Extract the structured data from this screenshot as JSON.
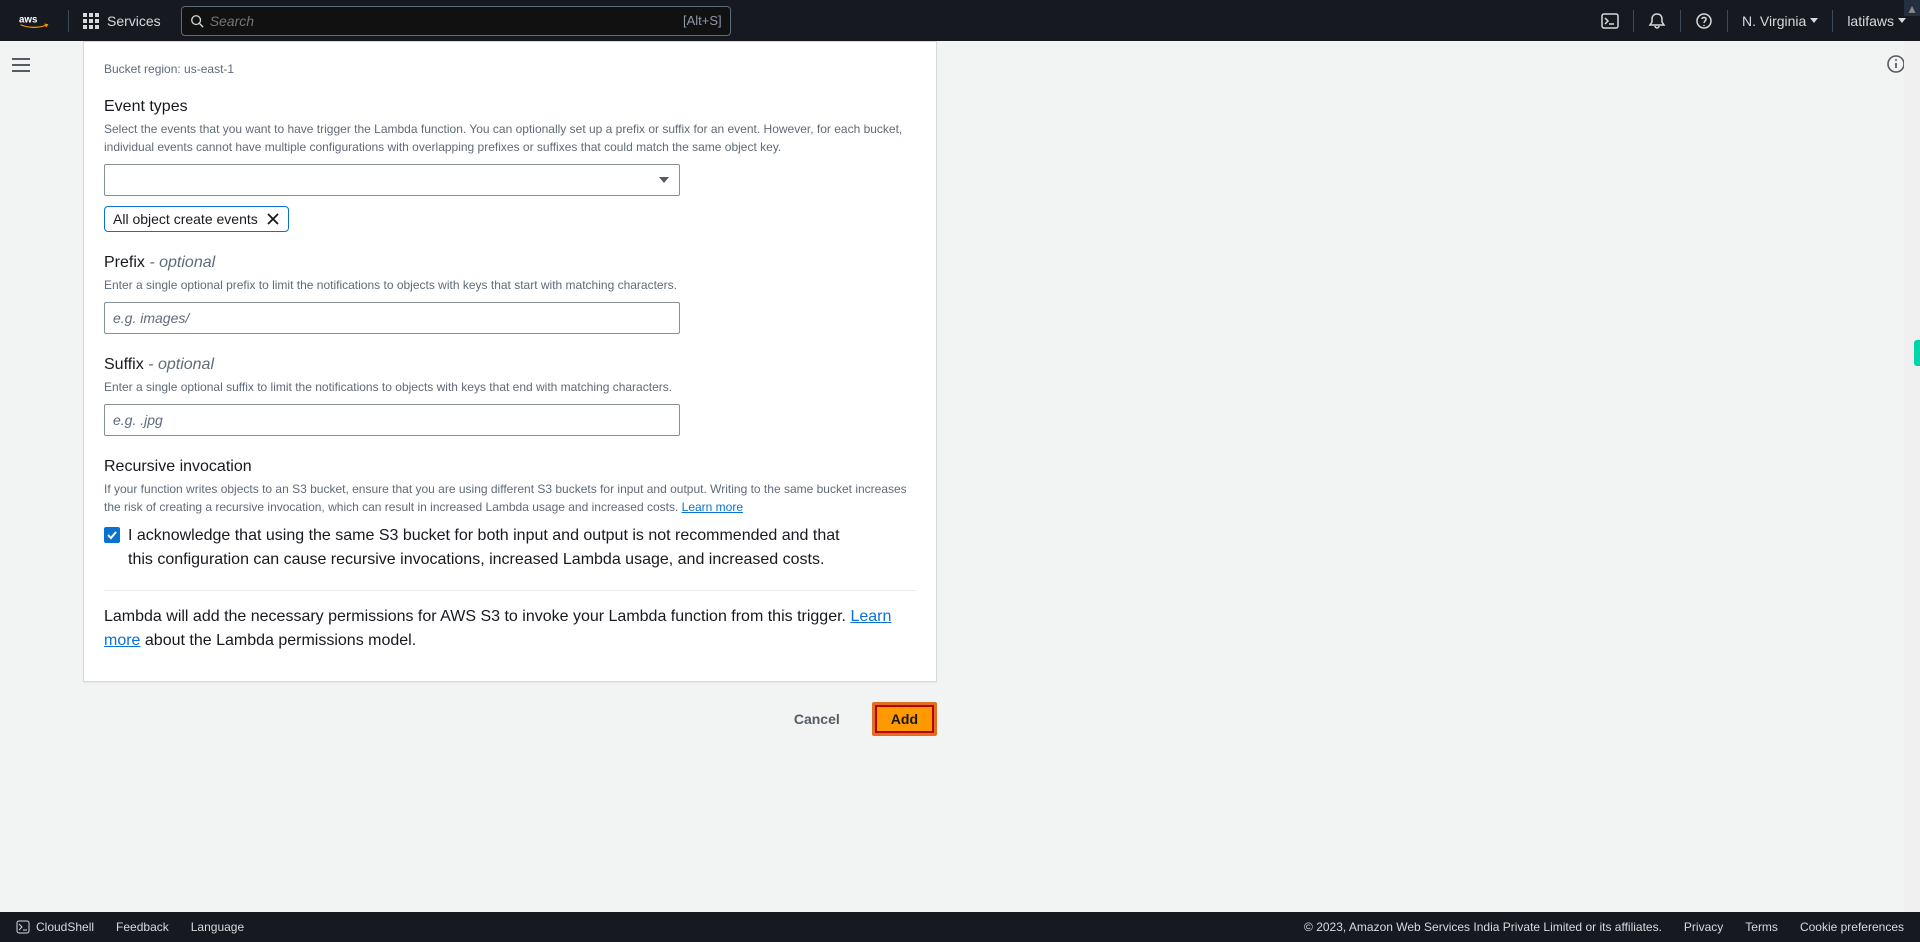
{
  "topnav": {
    "services_label": "Services",
    "search_placeholder": "Search",
    "search_shortcut": "[Alt+S]",
    "region": "N. Virginia",
    "user": "latifaws"
  },
  "form": {
    "bucket_region_label": "Bucket region: us-east-1",
    "event_types": {
      "label": "Event types",
      "desc": "Select the events that you want to have trigger the Lambda function. You can optionally set up a prefix or suffix for an event. However, for each bucket, individual events cannot have multiple configurations with overlapping prefixes or suffixes that could match the same object key.",
      "selected_tag": "All object create events"
    },
    "prefix": {
      "label": "Prefix",
      "optional": " - optional",
      "desc": "Enter a single optional prefix to limit the notifications to objects with keys that start with matching characters.",
      "placeholder": "e.g. images/"
    },
    "suffix": {
      "label": "Suffix",
      "optional": " - optional",
      "desc": "Enter a single optional suffix to limit the notifications to objects with keys that end with matching characters.",
      "placeholder": "e.g. .jpg"
    },
    "recursive": {
      "label": "Recursive invocation",
      "desc_pre": "If your function writes objects to an S3 bucket, ensure that you are using different S3 buckets for input and output. Writing to the same bucket increases the risk of creating a recursive invocation, which can result in increased Lambda usage and increased costs. ",
      "learn_more": "Learn more",
      "ack": "I acknowledge that using the same S3 bucket for both input and output is not recommended and that this configuration can cause recursive invocations, increased Lambda usage, and increased costs."
    },
    "permissions": {
      "text_pre": "Lambda will add the necessary permissions for AWS S3 to invoke your Lambda function from this trigger. ",
      "learn_more": "Learn more",
      "text_post": " about the Lambda permissions model."
    },
    "buttons": {
      "cancel": "Cancel",
      "add": "Add"
    }
  },
  "footer": {
    "cloudshell": "CloudShell",
    "feedback": "Feedback",
    "language": "Language",
    "copyright": "© 2023, Amazon Web Services India Private Limited or its affiliates.",
    "privacy": "Privacy",
    "terms": "Terms",
    "cookies": "Cookie preferences"
  }
}
